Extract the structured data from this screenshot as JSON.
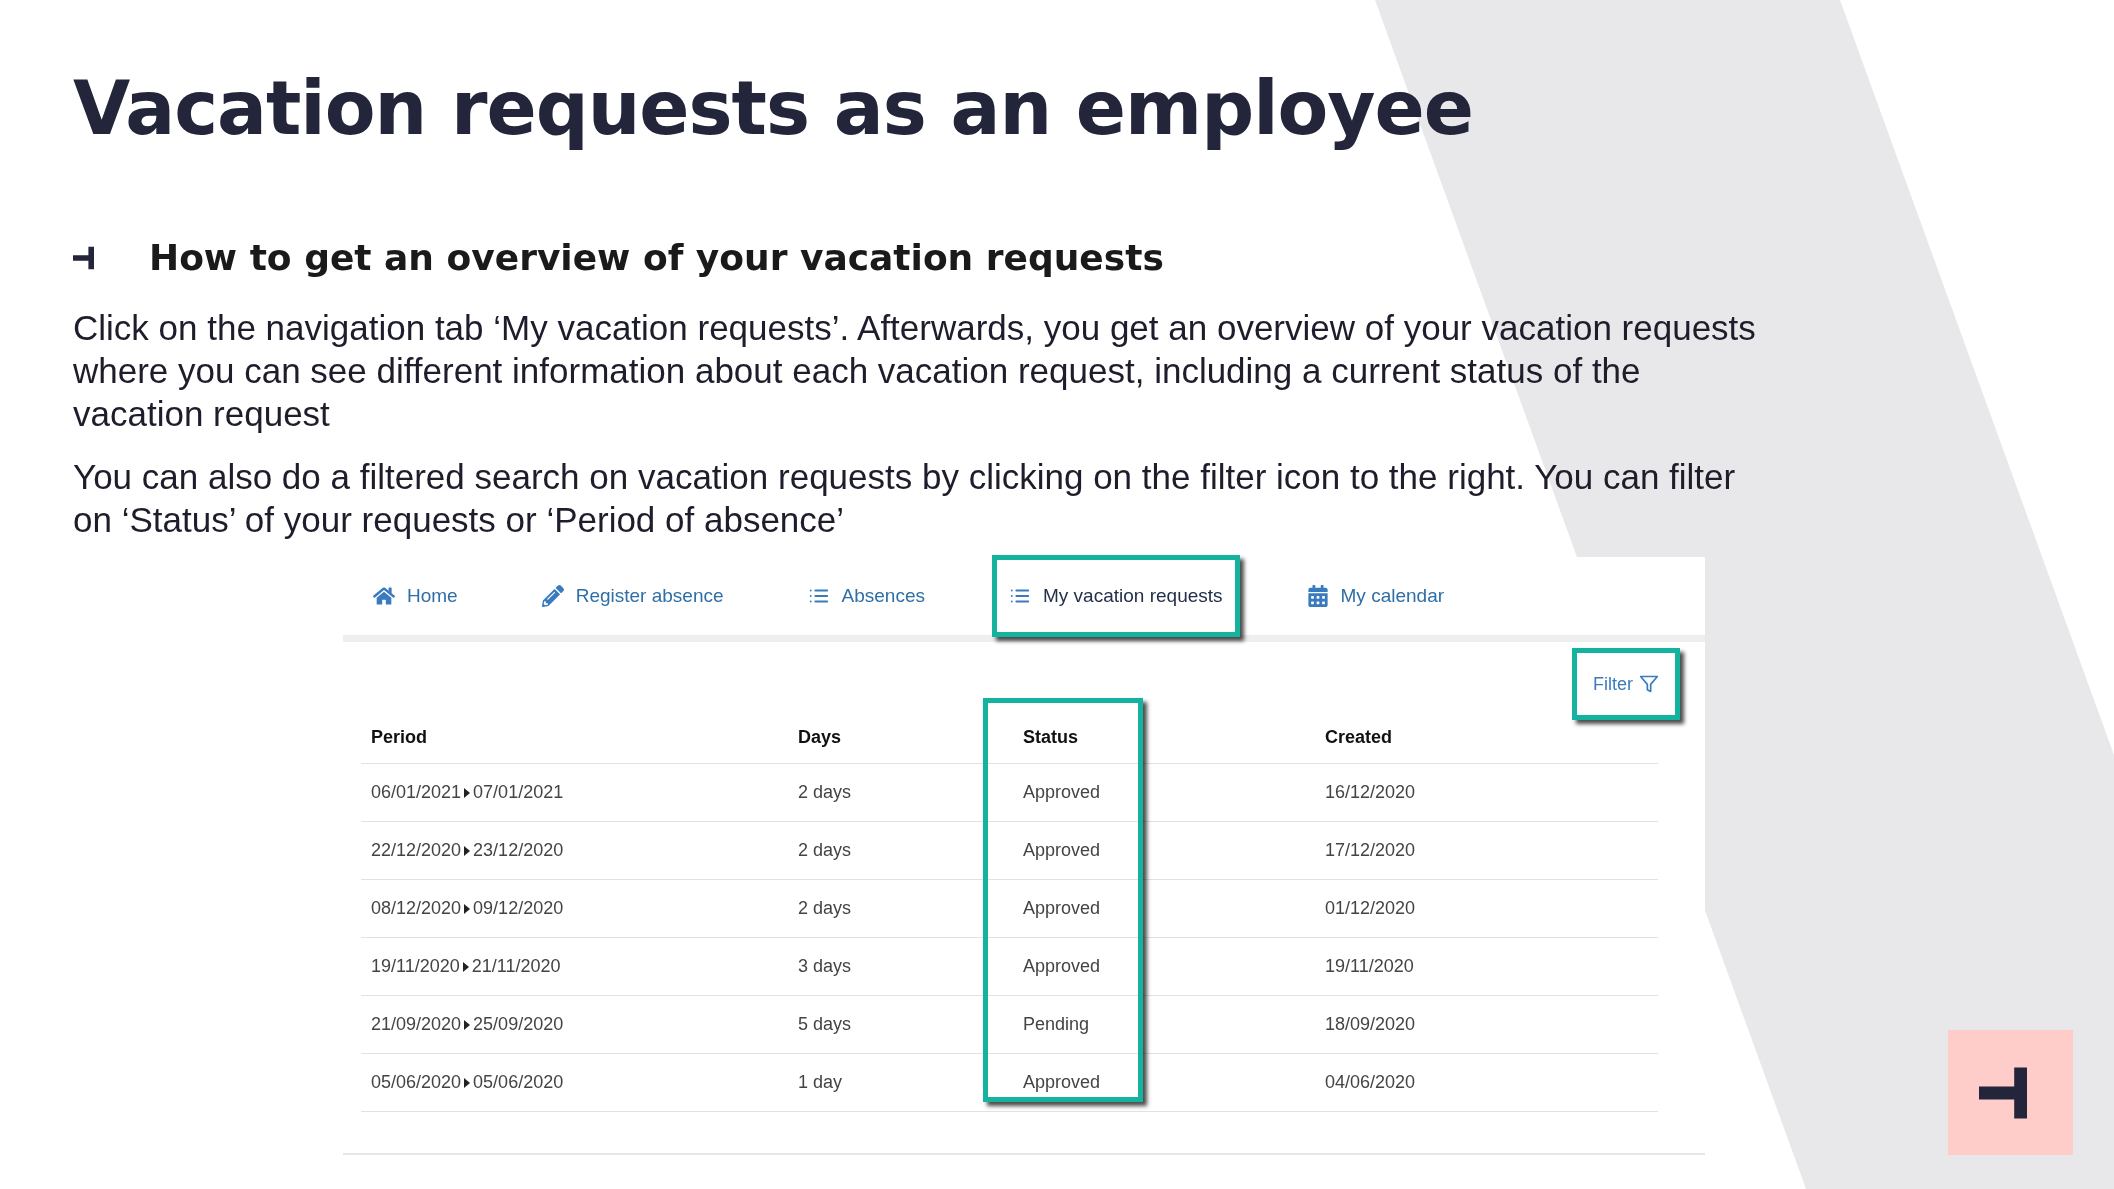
{
  "title": "Vacation requests as an employee",
  "section": {
    "heading": "How to get an overview of your vacation requests",
    "paragraphs": [
      "Click on the navigation tab ‘My vacation requests’. Afterwards, you get an overview of your vacation requests where you can see different information about each vacation request, including a current status of the vacation request",
      "You can also do a filtered search on vacation requests by clicking on the filter icon to the right. You can filter on ‘Status’ of your requests or ‘Period of absence’"
    ]
  },
  "app": {
    "nav": [
      {
        "label": "Home",
        "selected": false
      },
      {
        "label": "Register absence",
        "selected": false
      },
      {
        "label": "Absences",
        "selected": false
      },
      {
        "label": "My vacation requests",
        "selected": true
      },
      {
        "label": "My calendar",
        "selected": false
      }
    ],
    "filter": {
      "label": "Filter",
      "highlighted": true
    },
    "table": {
      "columns": [
        {
          "label": "Period",
          "highlighted": false
        },
        {
          "label": "Days",
          "highlighted": false
        },
        {
          "label": "Status",
          "highlighted": true
        },
        {
          "label": "Created",
          "highlighted": false
        }
      ],
      "rows": [
        {
          "from": "06/01/2021",
          "to": "07/01/2021",
          "days": "2 days",
          "status": "Approved",
          "created": "16/12/2020"
        },
        {
          "from": "22/12/2020",
          "to": "23/12/2020",
          "days": "2 days",
          "status": "Approved",
          "created": "17/12/2020"
        },
        {
          "from": "08/12/2020",
          "to": "09/12/2020",
          "days": "2 days",
          "status": "Approved",
          "created": "01/12/2020"
        },
        {
          "from": "19/11/2020",
          "to": "21/11/2020",
          "days": "3 days",
          "status": "Approved",
          "created": "19/11/2020"
        },
        {
          "from": "21/09/2020",
          "to": "25/09/2020",
          "days": "5 days",
          "status": "Pending",
          "created": "18/09/2020"
        },
        {
          "from": "05/06/2020",
          "to": "05/06/2020",
          "days": "1 day",
          "status": "Approved",
          "created": "04/06/2020"
        }
      ]
    }
  }
}
